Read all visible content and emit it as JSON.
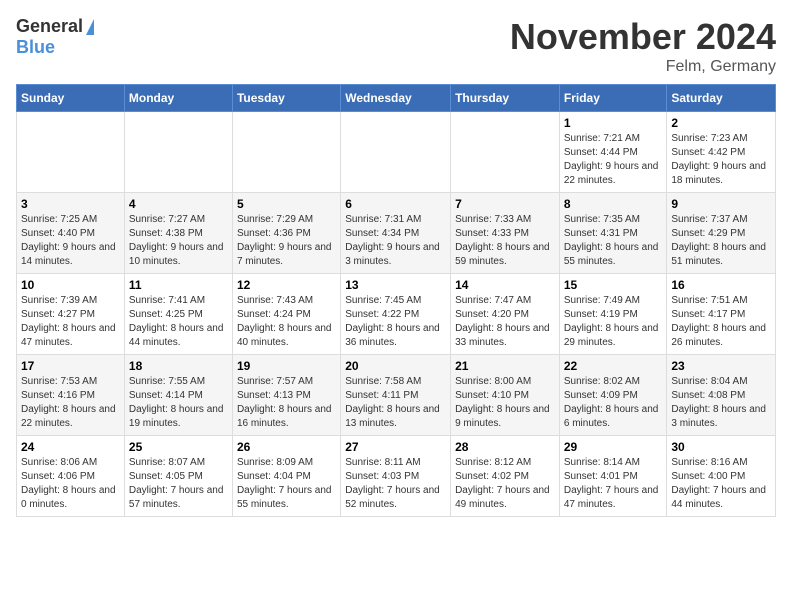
{
  "logo": {
    "text_general": "General",
    "text_blue": "Blue"
  },
  "header": {
    "month": "November 2024",
    "location": "Felm, Germany"
  },
  "days_of_week": [
    "Sunday",
    "Monday",
    "Tuesday",
    "Wednesday",
    "Thursday",
    "Friday",
    "Saturday"
  ],
  "weeks": [
    [
      {
        "day": "",
        "info": ""
      },
      {
        "day": "",
        "info": ""
      },
      {
        "day": "",
        "info": ""
      },
      {
        "day": "",
        "info": ""
      },
      {
        "day": "",
        "info": ""
      },
      {
        "day": "1",
        "info": "Sunrise: 7:21 AM\nSunset: 4:44 PM\nDaylight: 9 hours and 22 minutes."
      },
      {
        "day": "2",
        "info": "Sunrise: 7:23 AM\nSunset: 4:42 PM\nDaylight: 9 hours and 18 minutes."
      }
    ],
    [
      {
        "day": "3",
        "info": "Sunrise: 7:25 AM\nSunset: 4:40 PM\nDaylight: 9 hours and 14 minutes."
      },
      {
        "day": "4",
        "info": "Sunrise: 7:27 AM\nSunset: 4:38 PM\nDaylight: 9 hours and 10 minutes."
      },
      {
        "day": "5",
        "info": "Sunrise: 7:29 AM\nSunset: 4:36 PM\nDaylight: 9 hours and 7 minutes."
      },
      {
        "day": "6",
        "info": "Sunrise: 7:31 AM\nSunset: 4:34 PM\nDaylight: 9 hours and 3 minutes."
      },
      {
        "day": "7",
        "info": "Sunrise: 7:33 AM\nSunset: 4:33 PM\nDaylight: 8 hours and 59 minutes."
      },
      {
        "day": "8",
        "info": "Sunrise: 7:35 AM\nSunset: 4:31 PM\nDaylight: 8 hours and 55 minutes."
      },
      {
        "day": "9",
        "info": "Sunrise: 7:37 AM\nSunset: 4:29 PM\nDaylight: 8 hours and 51 minutes."
      }
    ],
    [
      {
        "day": "10",
        "info": "Sunrise: 7:39 AM\nSunset: 4:27 PM\nDaylight: 8 hours and 47 minutes."
      },
      {
        "day": "11",
        "info": "Sunrise: 7:41 AM\nSunset: 4:25 PM\nDaylight: 8 hours and 44 minutes."
      },
      {
        "day": "12",
        "info": "Sunrise: 7:43 AM\nSunset: 4:24 PM\nDaylight: 8 hours and 40 minutes."
      },
      {
        "day": "13",
        "info": "Sunrise: 7:45 AM\nSunset: 4:22 PM\nDaylight: 8 hours and 36 minutes."
      },
      {
        "day": "14",
        "info": "Sunrise: 7:47 AM\nSunset: 4:20 PM\nDaylight: 8 hours and 33 minutes."
      },
      {
        "day": "15",
        "info": "Sunrise: 7:49 AM\nSunset: 4:19 PM\nDaylight: 8 hours and 29 minutes."
      },
      {
        "day": "16",
        "info": "Sunrise: 7:51 AM\nSunset: 4:17 PM\nDaylight: 8 hours and 26 minutes."
      }
    ],
    [
      {
        "day": "17",
        "info": "Sunrise: 7:53 AM\nSunset: 4:16 PM\nDaylight: 8 hours and 22 minutes."
      },
      {
        "day": "18",
        "info": "Sunrise: 7:55 AM\nSunset: 4:14 PM\nDaylight: 8 hours and 19 minutes."
      },
      {
        "day": "19",
        "info": "Sunrise: 7:57 AM\nSunset: 4:13 PM\nDaylight: 8 hours and 16 minutes."
      },
      {
        "day": "20",
        "info": "Sunrise: 7:58 AM\nSunset: 4:11 PM\nDaylight: 8 hours and 13 minutes."
      },
      {
        "day": "21",
        "info": "Sunrise: 8:00 AM\nSunset: 4:10 PM\nDaylight: 8 hours and 9 minutes."
      },
      {
        "day": "22",
        "info": "Sunrise: 8:02 AM\nSunset: 4:09 PM\nDaylight: 8 hours and 6 minutes."
      },
      {
        "day": "23",
        "info": "Sunrise: 8:04 AM\nSunset: 4:08 PM\nDaylight: 8 hours and 3 minutes."
      }
    ],
    [
      {
        "day": "24",
        "info": "Sunrise: 8:06 AM\nSunset: 4:06 PM\nDaylight: 8 hours and 0 minutes."
      },
      {
        "day": "25",
        "info": "Sunrise: 8:07 AM\nSunset: 4:05 PM\nDaylight: 7 hours and 57 minutes."
      },
      {
        "day": "26",
        "info": "Sunrise: 8:09 AM\nSunset: 4:04 PM\nDaylight: 7 hours and 55 minutes."
      },
      {
        "day": "27",
        "info": "Sunrise: 8:11 AM\nSunset: 4:03 PM\nDaylight: 7 hours and 52 minutes."
      },
      {
        "day": "28",
        "info": "Sunrise: 8:12 AM\nSunset: 4:02 PM\nDaylight: 7 hours and 49 minutes."
      },
      {
        "day": "29",
        "info": "Sunrise: 8:14 AM\nSunset: 4:01 PM\nDaylight: 7 hours and 47 minutes."
      },
      {
        "day": "30",
        "info": "Sunrise: 8:16 AM\nSunset: 4:00 PM\nDaylight: 7 hours and 44 minutes."
      }
    ]
  ]
}
